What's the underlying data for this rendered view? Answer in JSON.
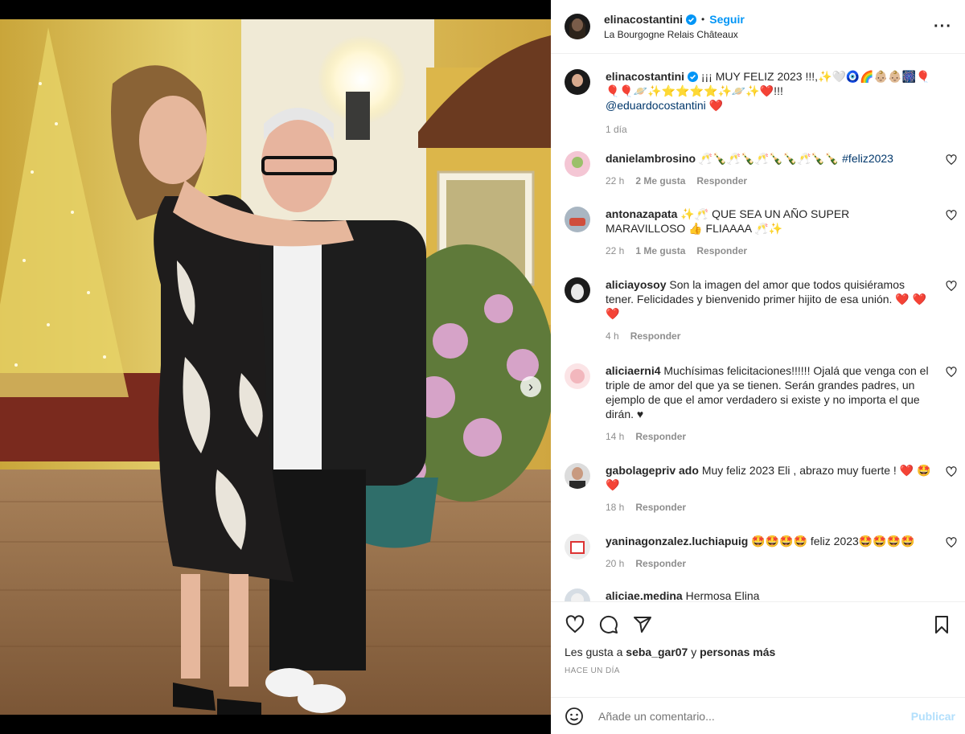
{
  "post": {
    "username": "elinacostantini",
    "follow_label": "Seguir",
    "location": "La Bourgogne Relais Châteaux",
    "caption": {
      "username": "elinacostantini",
      "text": "¡¡¡ MUY FELIZ 2023 !!!,✨🤍🧿🌈👶🏼👶🏼🎆🎈🎈🎈🪐✨⭐⭐⭐⭐✨🪐✨❤️!!!",
      "mention": "@eduardocostantini",
      "heart": "❤️",
      "time": "1 día"
    }
  },
  "comments": [
    {
      "username": "danielambrosino",
      "text": "🥂🍾🥂🍾🥂🍾🍾🥂🍾🍾",
      "hashtag": "#feliz2023",
      "time": "22 h",
      "likes": "2 Me gusta",
      "reply": "Responder"
    },
    {
      "username": "antonazapata",
      "text": "✨🥂 QUE SEA UN AÑO SUPER MARAVILLOSO 👍 FLIAAAA 🥂✨",
      "time": "22 h",
      "likes": "1 Me gusta",
      "reply": "Responder"
    },
    {
      "username": "aliciayosoy",
      "text": "Son la imagen del amor que todos quisiéramos tener. Felicidades y bienvenido primer hijito de esa unión. ❤️ ❤️❤️",
      "time": "4 h",
      "reply": "Responder"
    },
    {
      "username": "aliciaerni4",
      "text": "Muchísimas felicitaciones!!!!!! Ojalá que venga con el triple de amor del que ya se tienen. Serán grandes padres, un ejemplo de que el amor verdadero si existe y no importa el que dirán. ♥",
      "time": "14 h",
      "reply": "Responder"
    },
    {
      "username": "gabolagepriv ado",
      "text": "Muy feliz 2023 Eli , abrazo muy fuerte ! ❤️ 🤩❤️",
      "time": "18 h",
      "reply": "Responder"
    },
    {
      "username": "yaninagonzalez.luchiapuig",
      "text": "🤩🤩🤩🤩 feliz 2023🤩🤩🤩🤩",
      "time": "20 h",
      "reply": "Responder"
    },
    {
      "username": "aliciae.medina",
      "text": "Hermosa Elina",
      "time": "",
      "reply": ""
    }
  ],
  "footer": {
    "likes_prefix": "Les gusta a",
    "likes_user": "seba_gar07",
    "likes_middle": "y",
    "likes_others": "personas más",
    "timestamp": "HACE UN DÍA",
    "comment_placeholder": "Añade un comentario...",
    "post_label": "Publicar"
  },
  "colors": {
    "accent": "#0095f6",
    "post_disabled": "#b2dffc",
    "meta": "#8e8e8e",
    "heart": "#ed1b2f"
  }
}
